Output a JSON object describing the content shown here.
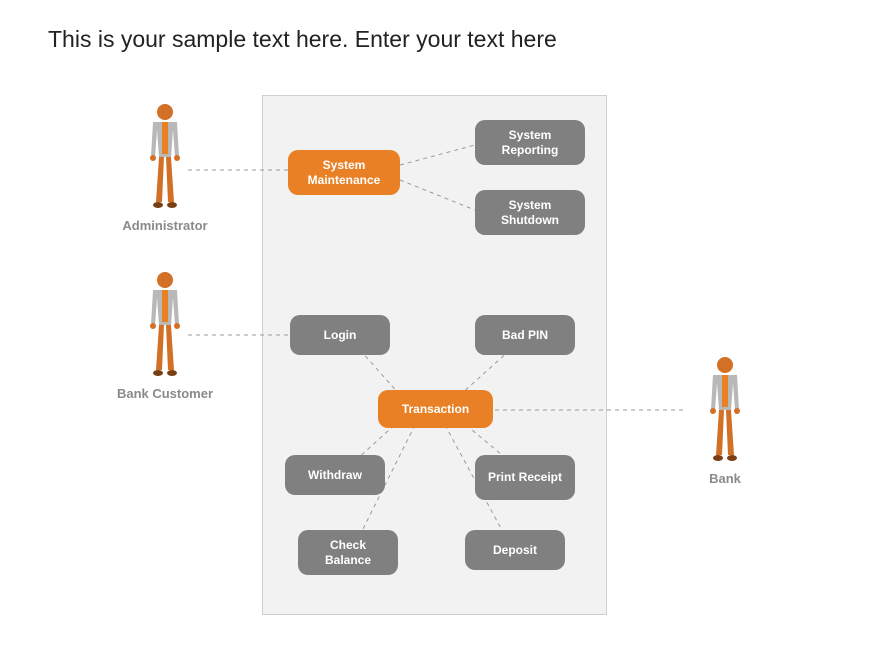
{
  "title": "This is your sample text here. Enter your text here",
  "actors": {
    "administrator": {
      "label": "Administrator"
    },
    "bankCustomer": {
      "label": "Bank Customer"
    },
    "bank": {
      "label": "Bank"
    }
  },
  "nodes": {
    "systemMaintenance": {
      "label": "System Maintenance"
    },
    "systemReporting": {
      "label": "System Reporting"
    },
    "systemShutdown": {
      "label": "System Shutdown"
    },
    "login": {
      "label": "Login"
    },
    "badPin": {
      "label": "Bad PIN"
    },
    "transaction": {
      "label": "Transaction"
    },
    "withdraw": {
      "label": "Withdraw"
    },
    "printReceipt": {
      "label": "Print Receipt"
    },
    "checkBalance": {
      "label": "Check Balance"
    },
    "deposit": {
      "label": "Deposit"
    }
  },
  "colors": {
    "orange": "#e98025",
    "grayNode": "#808080",
    "panel": "#f2f2f2",
    "border": "#cfcfcf",
    "labelText": "#8a8a8a"
  }
}
